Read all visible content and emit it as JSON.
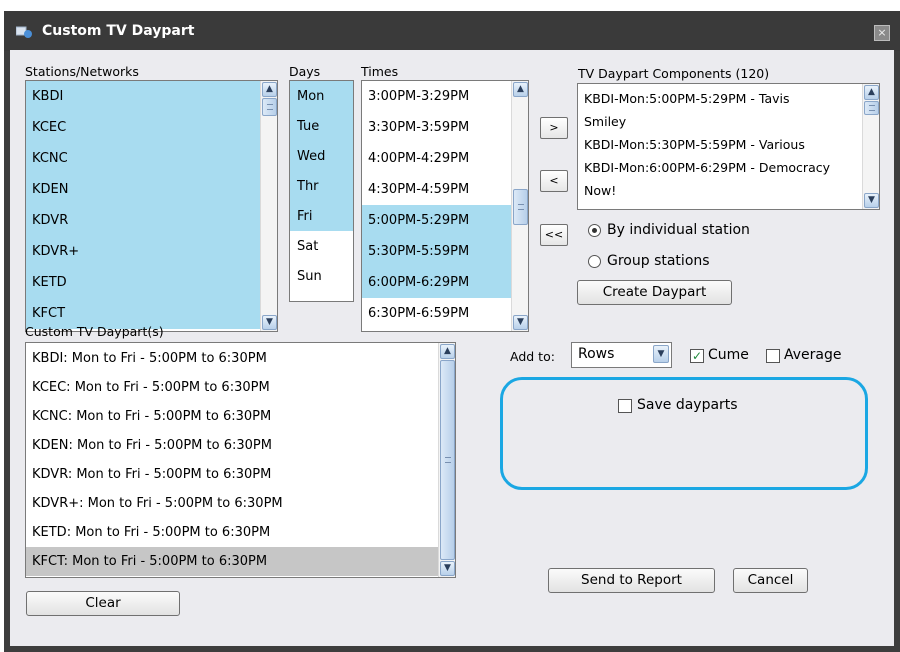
{
  "window": {
    "title": "Custom TV Daypart",
    "close_glyph": "×"
  },
  "stations": {
    "label": "Stations/Networks",
    "items": [
      {
        "text": "KBDI",
        "selected": true
      },
      {
        "text": "KCEC",
        "selected": true
      },
      {
        "text": "KCNC",
        "selected": true
      },
      {
        "text": "KDEN",
        "selected": true
      },
      {
        "text": "KDVR",
        "selected": true
      },
      {
        "text": "KDVR+",
        "selected": true
      },
      {
        "text": "KETD",
        "selected": true
      },
      {
        "text": "KFCT",
        "selected": true
      }
    ]
  },
  "days": {
    "label": "Days",
    "items": [
      {
        "text": "Mon",
        "selected": true
      },
      {
        "text": "Tue",
        "selected": true
      },
      {
        "text": "Wed",
        "selected": true
      },
      {
        "text": "Thr",
        "selected": true
      },
      {
        "text": "Fri",
        "selected": true
      },
      {
        "text": "Sat",
        "selected": false
      },
      {
        "text": "Sun",
        "selected": false
      }
    ]
  },
  "times": {
    "label": "Times",
    "items": [
      {
        "text": "3:00PM-3:29PM",
        "selected": false
      },
      {
        "text": "3:30PM-3:59PM",
        "selected": false
      },
      {
        "text": "4:00PM-4:29PM",
        "selected": false
      },
      {
        "text": "4:30PM-4:59PM",
        "selected": false
      },
      {
        "text": "5:00PM-5:29PM",
        "selected": true
      },
      {
        "text": "5:30PM-5:59PM",
        "selected": true
      },
      {
        "text": "6:00PM-6:29PM",
        "selected": true
      },
      {
        "text": "6:30PM-6:59PM",
        "selected": false
      }
    ]
  },
  "move_buttons": {
    "add": ">",
    "remove": "<",
    "remove_all": "<<"
  },
  "components": {
    "label": "TV Daypart Components (120)",
    "lines": [
      "KBDI-Mon:5:00PM-5:29PM - Tavis",
      "Smiley",
      "KBDI-Mon:5:30PM-5:59PM - Various",
      "KBDI-Mon:6:00PM-6:29PM - Democracy",
      "Now!"
    ]
  },
  "grouping": {
    "by_station": {
      "label": "By individual station",
      "selected": true
    },
    "group": {
      "label": "Group stations",
      "selected": false
    }
  },
  "create_daypart": {
    "label": "Create Daypart"
  },
  "custom_dayparts": {
    "label": "Custom TV Daypart(s)",
    "items": [
      {
        "text": "KBDI: Mon to Fri - 5:00PM to 6:30PM",
        "selected": false
      },
      {
        "text": "KCEC: Mon to Fri - 5:00PM to 6:30PM",
        "selected": false
      },
      {
        "text": "KCNC: Mon to Fri - 5:00PM to 6:30PM",
        "selected": false
      },
      {
        "text": "KDEN: Mon to Fri - 5:00PM to 6:30PM",
        "selected": false
      },
      {
        "text": "KDVR: Mon to Fri - 5:00PM to 6:30PM",
        "selected": false
      },
      {
        "text": "KDVR+: Mon to Fri - 5:00PM to 6:30PM",
        "selected": false
      },
      {
        "text": "KETD: Mon to Fri - 5:00PM to 6:30PM",
        "selected": false
      },
      {
        "text": "KFCT: Mon to Fri - 5:00PM to 6:30PM",
        "selected": true
      }
    ]
  },
  "add_to": {
    "label": "Add to:",
    "value": "Rows"
  },
  "cume": {
    "label": "Cume",
    "checked": true
  },
  "average": {
    "label": "Average",
    "checked": false
  },
  "save_dayparts": {
    "label": "Save dayparts",
    "checked": false
  },
  "buttons": {
    "send_to_report": "Send to Report",
    "cancel": "Cancel",
    "clear": "Clear"
  },
  "colors": {
    "selection": "#a8dcf0",
    "highlight": "#1aa7e3",
    "title_bar": "#3a3a3a",
    "client_bg": "#ebebef"
  }
}
